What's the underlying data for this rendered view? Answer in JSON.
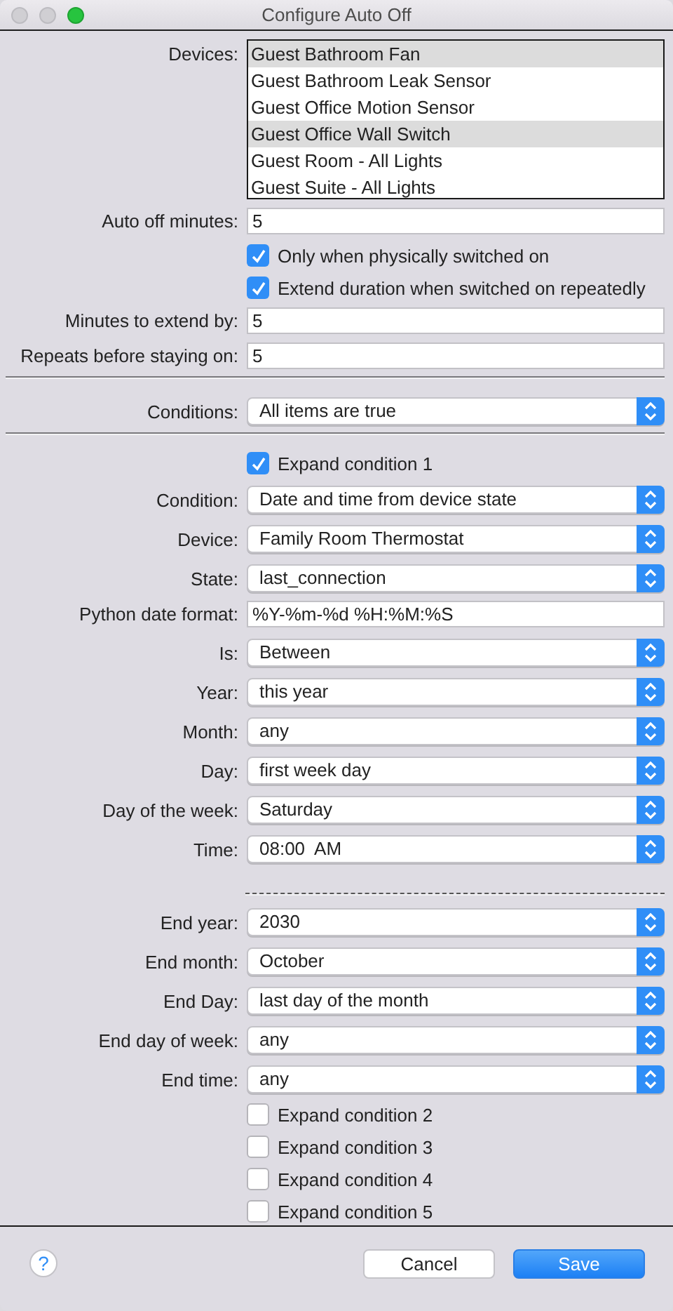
{
  "window": {
    "title": "Configure Auto Off"
  },
  "form": [
    {
      "kind": "list",
      "label": "Devices:",
      "items": [
        {
          "text": "Guest Bathroom Fan",
          "selected": true
        },
        {
          "text": "Guest Bathroom Leak Sensor",
          "selected": false
        },
        {
          "text": "Guest Office Motion Sensor",
          "selected": false
        },
        {
          "text": "Guest Office Wall Switch",
          "selected": true
        },
        {
          "text": "Guest Room - All Lights",
          "selected": false
        },
        {
          "text": "Guest Suite - All Lights",
          "selected": false
        }
      ]
    },
    {
      "kind": "field",
      "label": "Auto off minutes:",
      "value": "5"
    },
    {
      "kind": "checkbox",
      "text": "Only when physically switched on",
      "checked": true
    },
    {
      "kind": "checkbox",
      "text": "Extend duration when switched on repeatedly",
      "checked": true
    },
    {
      "kind": "field",
      "label": "Minutes to extend by:",
      "value": "5"
    },
    {
      "kind": "field",
      "label": "Repeats before staying on:",
      "value": "5"
    },
    {
      "kind": "separator"
    },
    {
      "kind": "select",
      "label": "Conditions:",
      "value": "All items are true"
    },
    {
      "kind": "separator"
    },
    {
      "kind": "checkbox",
      "text": "Expand condition 1",
      "checked": true
    },
    {
      "kind": "select",
      "label": "Condition:",
      "value": "Date and time from device state"
    },
    {
      "kind": "select",
      "label": "Device:",
      "value": "Family Room Thermostat"
    },
    {
      "kind": "select",
      "label": "State:",
      "value": "last_connection"
    },
    {
      "kind": "field",
      "label": "Python date format:",
      "value": "%Y-%m-%d %H:%M:%S"
    },
    {
      "kind": "select",
      "label": "Is:",
      "value": "Between"
    },
    {
      "kind": "select",
      "label": "Year:",
      "value": "this year"
    },
    {
      "kind": "select",
      "label": "Month:",
      "value": "any"
    },
    {
      "kind": "select",
      "label": "Day:",
      "value": "first week day"
    },
    {
      "kind": "select",
      "label": "Day of the week:",
      "value": "Saturday"
    },
    {
      "kind": "select",
      "label": "Time:",
      "value": "08:00  AM"
    },
    {
      "kind": "dashed"
    },
    {
      "kind": "select",
      "label": "End year:",
      "value": "2030"
    },
    {
      "kind": "select",
      "label": "End month:",
      "value": "October"
    },
    {
      "kind": "select",
      "label": "End Day:",
      "value": "last day of the month"
    },
    {
      "kind": "select",
      "label": "End day of week:",
      "value": "any"
    },
    {
      "kind": "select",
      "label": "End time:",
      "value": "any"
    },
    {
      "kind": "checkbox",
      "text": "Expand condition 2",
      "checked": false
    },
    {
      "kind": "checkbox",
      "text": "Expand condition 3",
      "checked": false
    },
    {
      "kind": "checkbox",
      "text": "Expand condition 4",
      "checked": false
    },
    {
      "kind": "checkbox",
      "text": "Expand condition 5",
      "checked": false
    }
  ],
  "footer": {
    "help": "?",
    "buttons": [
      {
        "label": "Cancel",
        "kind": "secondary"
      },
      {
        "label": "Save",
        "kind": "primary"
      }
    ]
  }
}
